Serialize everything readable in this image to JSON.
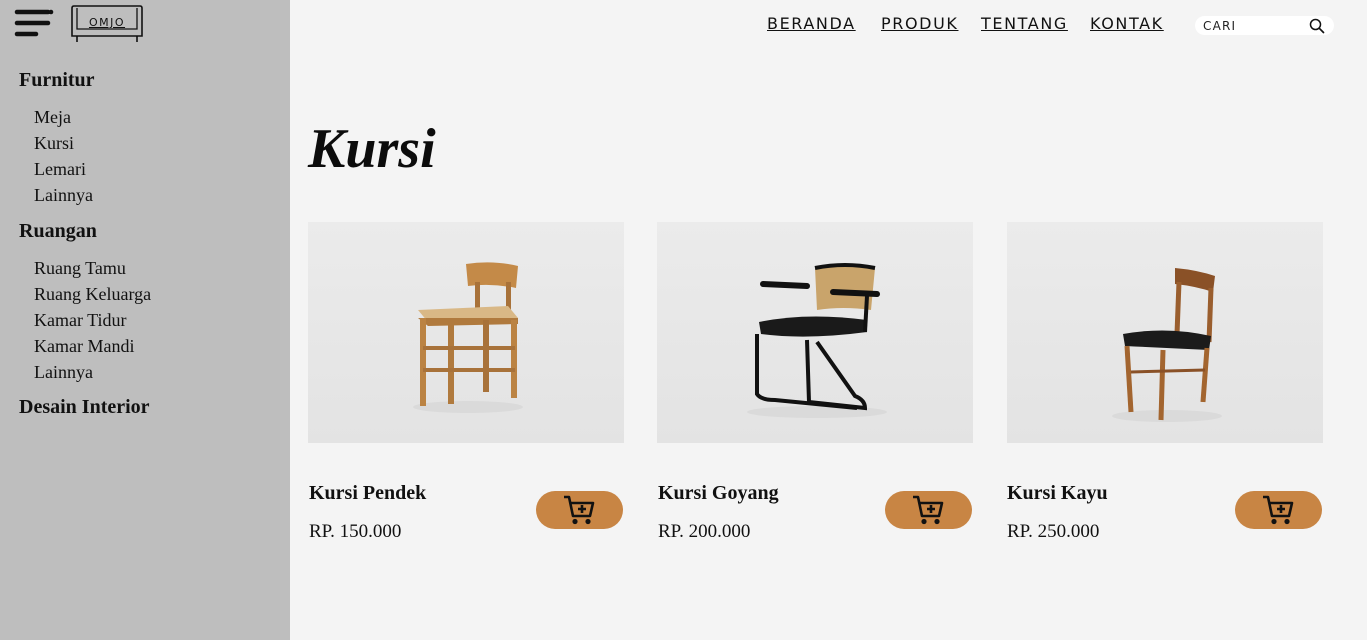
{
  "brand": {
    "logo_text": "OMJO"
  },
  "nav": {
    "items": [
      "BERANDA",
      "PRODUK",
      "TENTANG",
      "KONTAK"
    ]
  },
  "search": {
    "placeholder": "CARI"
  },
  "sidebar": {
    "categories": [
      {
        "title": "Furnitur",
        "items": [
          "Meja",
          "Kursi",
          "Lemari",
          "Lainnya"
        ]
      },
      {
        "title": "Ruangan",
        "items": [
          "Ruang Tamu",
          "Ruang Keluarga",
          "Kamar Tidur",
          "Kamar Mandi",
          "Lainnya"
        ]
      },
      {
        "title": "Desain Interior",
        "items": []
      }
    ]
  },
  "page": {
    "title": "Kursi"
  },
  "products": [
    {
      "name": "Kursi Pendek",
      "price": "RP. 150.000"
    },
    {
      "name": "Kursi Goyang",
      "price": "RP. 200.000"
    },
    {
      "name": "Kursi Kayu",
      "price": "RP. 250.000"
    }
  ],
  "colors": {
    "sidebar_bg": "#bebebe",
    "page_bg": "#f4f4f4",
    "cart_button": "#c88544"
  }
}
